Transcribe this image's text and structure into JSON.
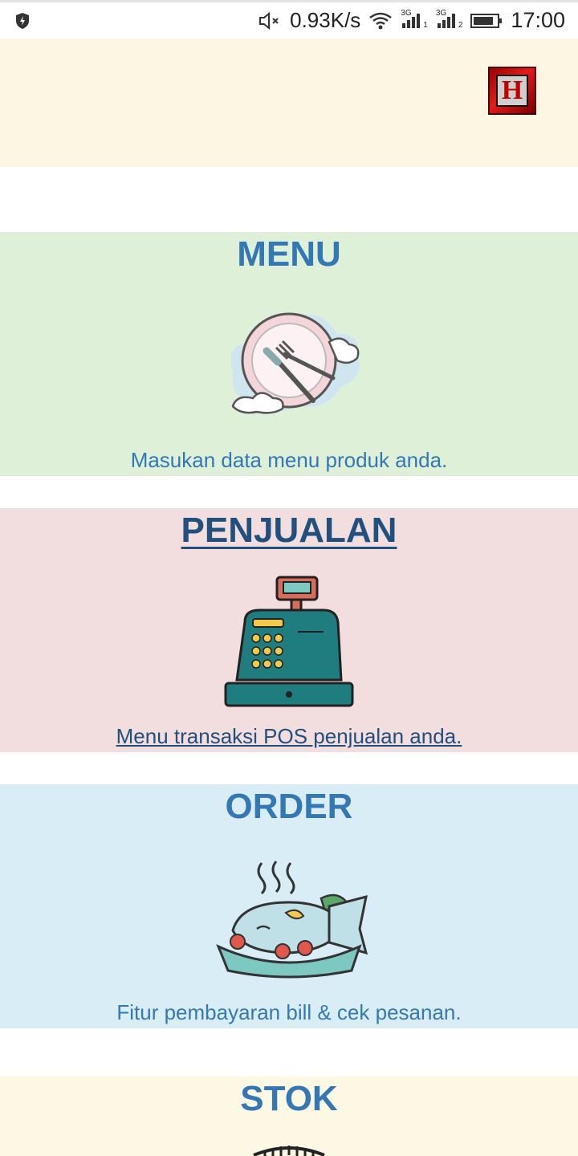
{
  "status_bar": {
    "speed": "0.93K/s",
    "network_1": "3G",
    "network_2": "3G",
    "sim_1": "1",
    "sim_2": "2",
    "time": "17:00",
    "icons": [
      "shield-icon",
      "mute-icon",
      "wifi-icon",
      "signal-icon",
      "battery-icon"
    ]
  },
  "header": {
    "logo_letter": "H"
  },
  "cards": [
    {
      "title": "MENU",
      "description": "Masukan data menu produk anda.",
      "bg": "#dff0d8",
      "icon": "plate-cutlery-icon"
    },
    {
      "title": "PENJUALAN",
      "description": "Menu transaksi POS penjualan anda.",
      "bg": "#f2dede",
      "icon": "cash-register-icon"
    },
    {
      "title": "ORDER",
      "description": "Fitur pembayaran bill & cek pesanan.",
      "bg": "#d9edf7",
      "icon": "fish-dish-icon"
    },
    {
      "title": "STOK",
      "description": "",
      "bg": "#fcf8e3",
      "icon": "stock-icon"
    }
  ],
  "colors": {
    "title": "#3378b5",
    "link": "#22507e",
    "header_bg": "#fdf6e3"
  }
}
